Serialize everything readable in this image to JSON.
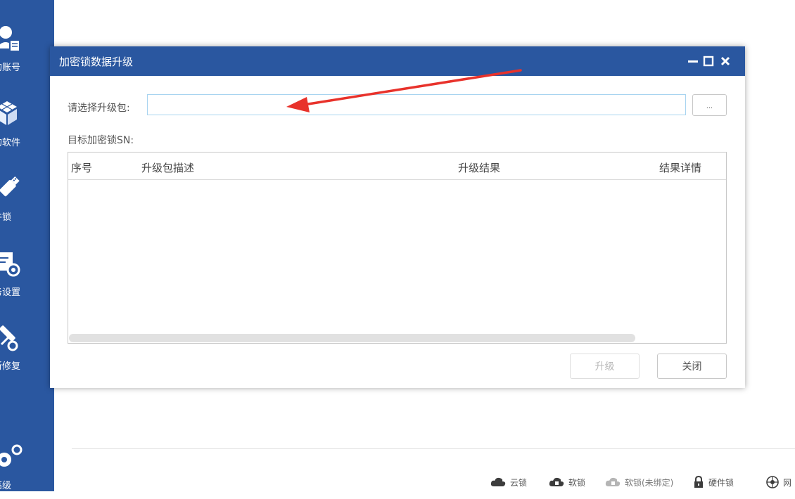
{
  "sidebar": {
    "items": [
      {
        "label": "的账号",
        "icon": "account-icon"
      },
      {
        "label": "的软件",
        "icon": "software-cube-icon"
      },
      {
        "label": "件锁",
        "icon": "usb-key-icon"
      },
      {
        "label": "务设置",
        "icon": "service-settings-icon"
      },
      {
        "label": "新修复",
        "icon": "repair-tools-icon"
      },
      {
        "label": "高级",
        "icon": "gears-icon"
      }
    ]
  },
  "dialog": {
    "title": "加密锁数据升级",
    "package_label": "请选择升级包:",
    "package_value": "",
    "browse_label": "...",
    "sn_label": "目标加密锁SN:",
    "columns": [
      "序号",
      "升级包描述",
      "升级结果",
      "结果详情"
    ],
    "rows": [],
    "upgrade_label": "升级",
    "close_label": "关闭"
  },
  "statusbar": {
    "items": [
      {
        "label": "云锁",
        "icon": "cloud-icon"
      },
      {
        "label": "软锁",
        "icon": "cloud-lock-icon"
      },
      {
        "label": "软锁(未绑定)",
        "icon": "cloud-unbound-icon"
      },
      {
        "label": "硬件锁",
        "icon": "padlock-icon"
      },
      {
        "label": "网",
        "icon": "network-icon"
      }
    ]
  },
  "colors": {
    "accent": "#2a57a0",
    "annotation_arrow": "#e8322b"
  }
}
